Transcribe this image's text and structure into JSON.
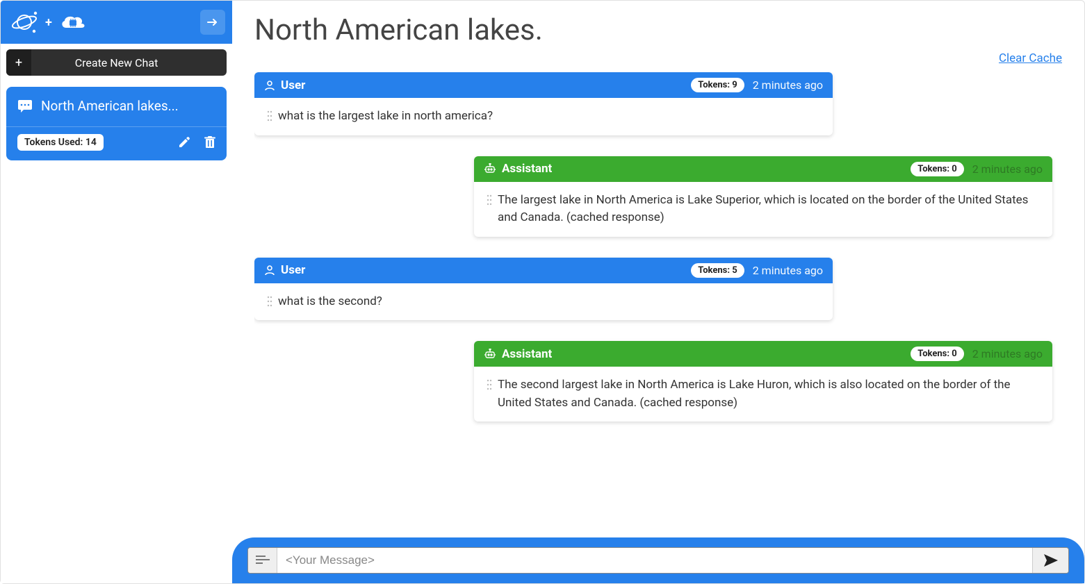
{
  "header": {
    "collapse_icon": "arrow-right"
  },
  "sidebar": {
    "new_chat_label": "Create New Chat",
    "chat": {
      "title": "North American lakes...",
      "tokens_label": "Tokens Used: 14"
    }
  },
  "main": {
    "title": "North American lakes.",
    "clear_cache_label": "Clear Cache"
  },
  "composer": {
    "placeholder": "<Your Message>"
  },
  "messages": [
    {
      "role": "User",
      "tokens": "Tokens: 9",
      "time": "2 minutes ago",
      "text": "what is the largest lake in north america?"
    },
    {
      "role": "Assistant",
      "tokens": "Tokens: 0",
      "time": "2 minutes ago",
      "text": "The largest lake in North America is Lake Superior, which is located on the border of the United States and Canada. (cached response)"
    },
    {
      "role": "User",
      "tokens": "Tokens: 5",
      "time": "2 minutes ago",
      "text": "what is the second?"
    },
    {
      "role": "Assistant",
      "tokens": "Tokens: 0",
      "time": "2 minutes ago",
      "text": "The second largest lake in North America is Lake Huron, which is also located on the border of the United States and Canada. (cached response)"
    }
  ]
}
